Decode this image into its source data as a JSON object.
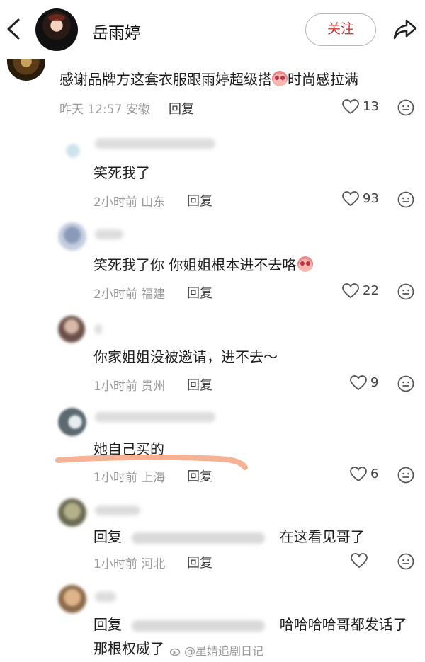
{
  "header": {
    "username": "岳雨婷",
    "follow_label": "关注"
  },
  "comments": [
    {
      "id": "c1",
      "text": "感谢品牌方这套衣服跟雨婷超级搭",
      "text_suffix": "时尚感拉满",
      "time": "昨天 12:57",
      "location": "安徽",
      "reply_label": "回复",
      "likes": "13"
    },
    {
      "id": "c2",
      "text": "笑死我了",
      "time": "2小时前",
      "location": "山东",
      "reply_label": "回复",
      "likes": "93"
    },
    {
      "id": "c3",
      "text": "笑死我了你 你姐姐根本进不去咯",
      "time": "2小时前",
      "location": "福建",
      "reply_label": "回复",
      "likes": "22"
    },
    {
      "id": "c4",
      "text": "你家姐姐没被邀请，进不去～",
      "time": "1小时前",
      "location": "贵州",
      "reply_label": "回复",
      "likes": "9"
    },
    {
      "id": "c5",
      "text": "她自己买的",
      "time": "1小时前",
      "location": "上海",
      "reply_label": "回复",
      "likes": "6"
    },
    {
      "id": "c6",
      "text_prefix": "回复",
      "text": "在这看见哥了",
      "time": "1小时前",
      "location": "河北",
      "reply_label": "回复"
    },
    {
      "id": "c7",
      "text_prefix": "回复",
      "text": "哈哈哈哈哥都发话了",
      "text_line2": "那根权威了"
    }
  ],
  "watermark": "@星婧追剧日记",
  "colors": {
    "follow_text": "#d3393b",
    "highlight_stroke": "#f4a582",
    "meta_gray": "#9a9a9a"
  }
}
